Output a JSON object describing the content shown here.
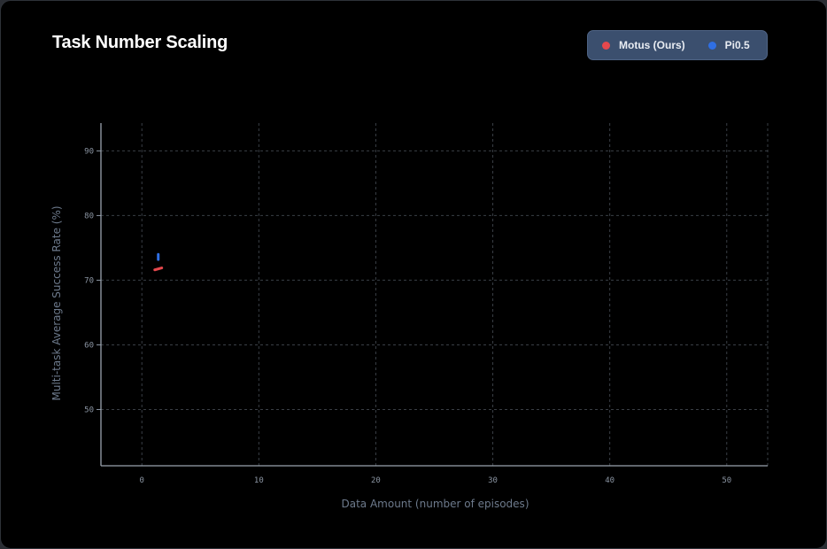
{
  "title": "Task Number Scaling",
  "legend": {
    "items": [
      {
        "label": "Motus (Ours)",
        "color": "#e5484d"
      },
      {
        "label": "Pi0.5",
        "color": "#2f6fe4"
      }
    ]
  },
  "chart_data": {
    "type": "line",
    "title": "Task Number Scaling",
    "xlabel": "Data Amount (number of episodes)",
    "ylabel": "Multi-task Average Success Rate (%)",
    "xlim": [
      -3.5,
      53.5
    ],
    "ylim": [
      41.3,
      94.3
    ],
    "xticks": [
      0,
      10,
      20,
      30,
      40,
      50
    ],
    "yticks": [
      50,
      60,
      70,
      80,
      90
    ],
    "grid": true,
    "legend_position": "top-right",
    "series": [
      {
        "name": "Motus (Ours)",
        "color": "#e5484d",
        "x": [
          1.1,
          1.7
        ],
        "y": [
          71.6,
          71.9
        ]
      },
      {
        "name": "Pi0.5",
        "color": "#2f6fe4",
        "x": [
          1.4,
          1.4
        ],
        "y": [
          73.2,
          74.0
        ]
      }
    ]
  }
}
